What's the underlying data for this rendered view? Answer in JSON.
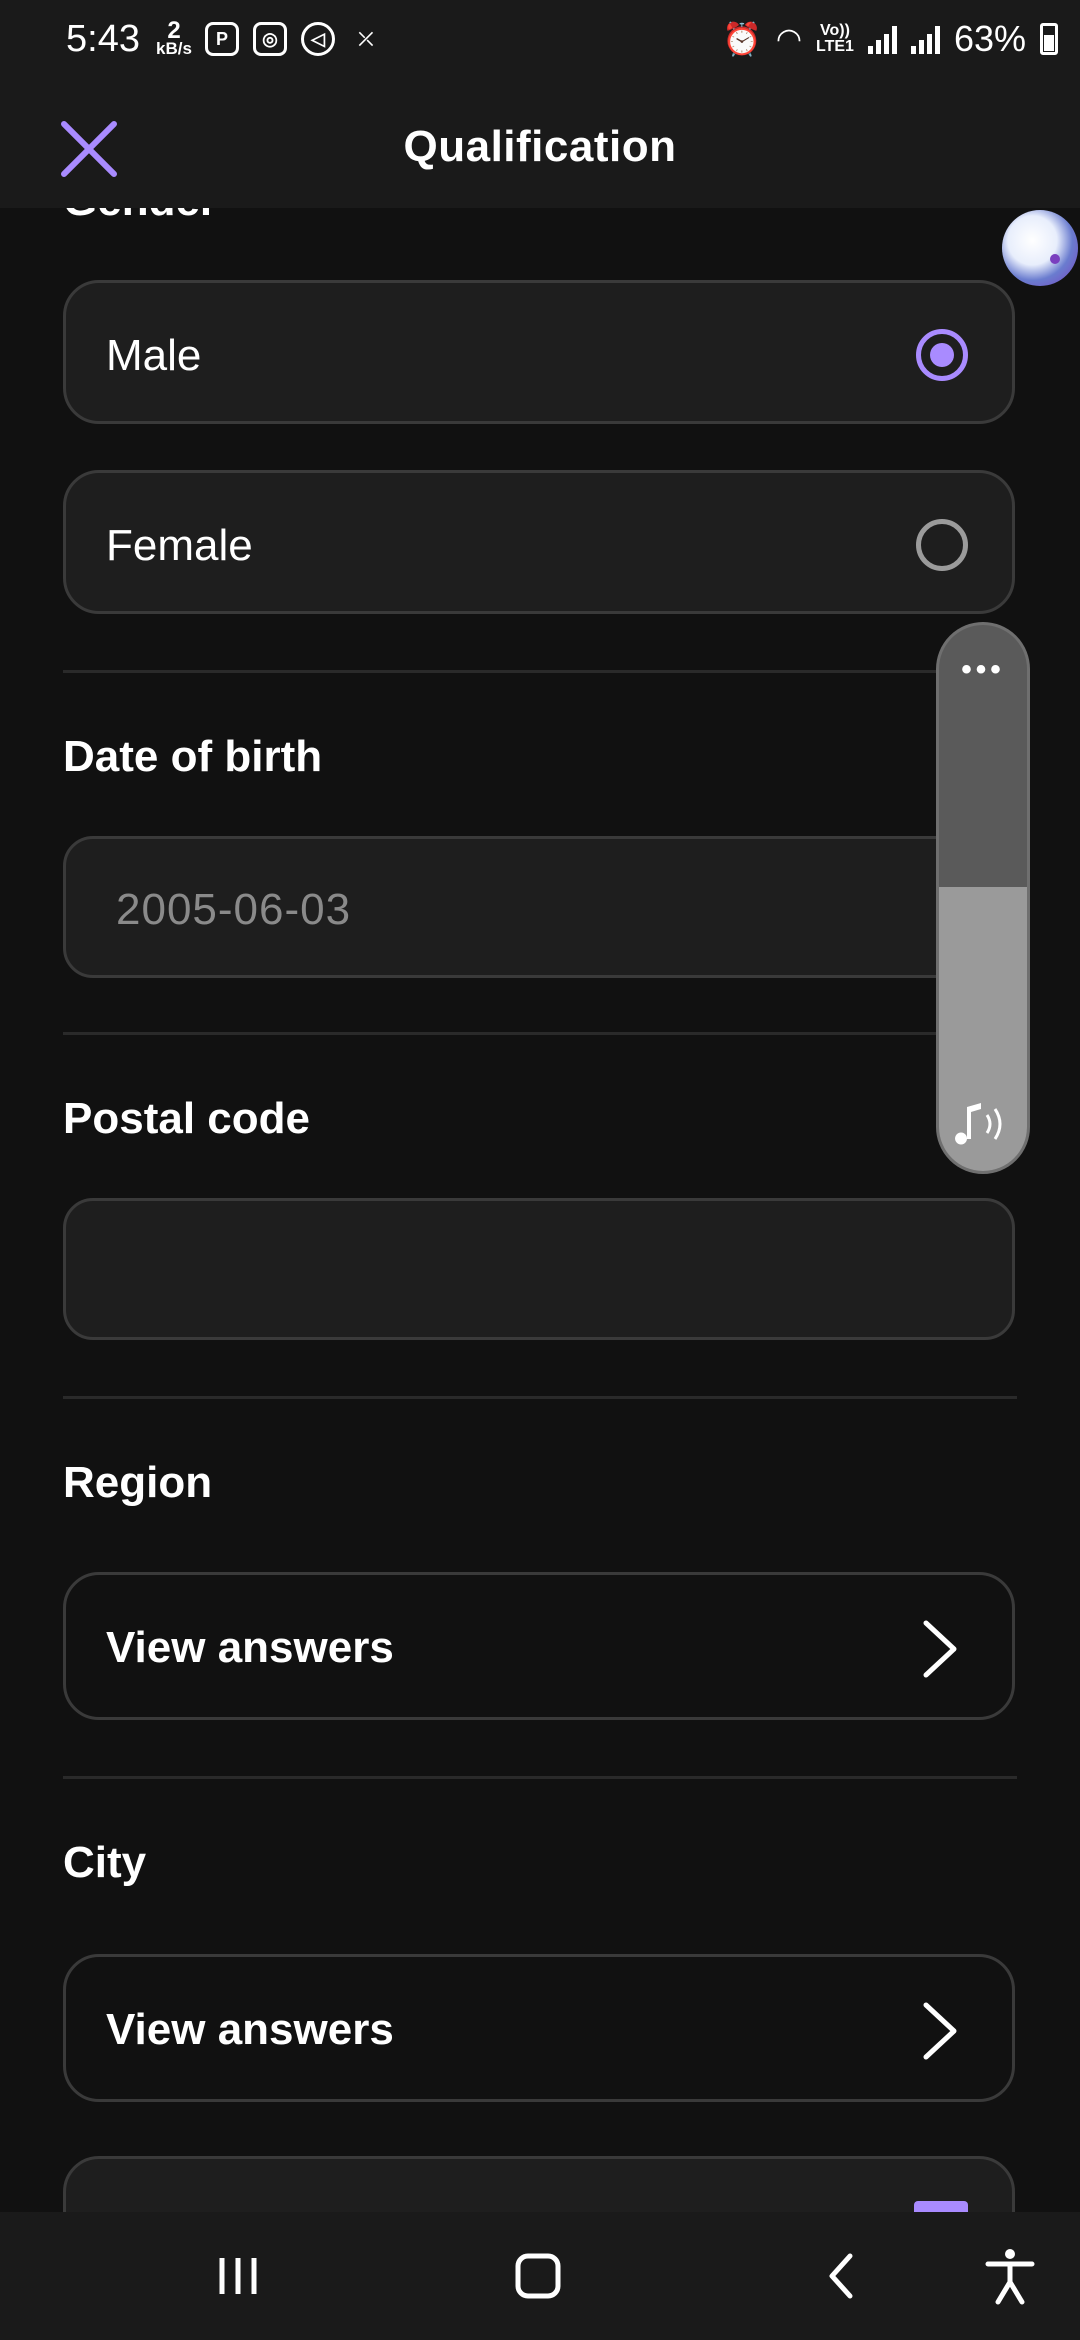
{
  "status_bar": {
    "time": "5:43",
    "net_speed_value": "2",
    "net_speed_unit": "kB/s",
    "volte": "Vo))",
    "lte": "LTE1",
    "battery": "63%"
  },
  "header": {
    "title": "Qualification",
    "close_icon": "close-icon"
  },
  "gender": {
    "title_partial": "Gender",
    "options": [
      {
        "label": "Male",
        "selected": true
      },
      {
        "label": "Female",
        "selected": false
      }
    ]
  },
  "date_of_birth": {
    "title": "Date of birth",
    "value": "2005-06-03"
  },
  "postal_code": {
    "title": "Postal code",
    "value": ""
  },
  "region": {
    "title": "Region",
    "button_label": "View answers"
  },
  "city": {
    "title": "City",
    "button_label": "View answers"
  },
  "volume_panel": {
    "more_label": "•••",
    "level": 0.52
  },
  "colors": {
    "accent": "#a98bff",
    "background": "#111111",
    "card": "#1e1e1e"
  }
}
